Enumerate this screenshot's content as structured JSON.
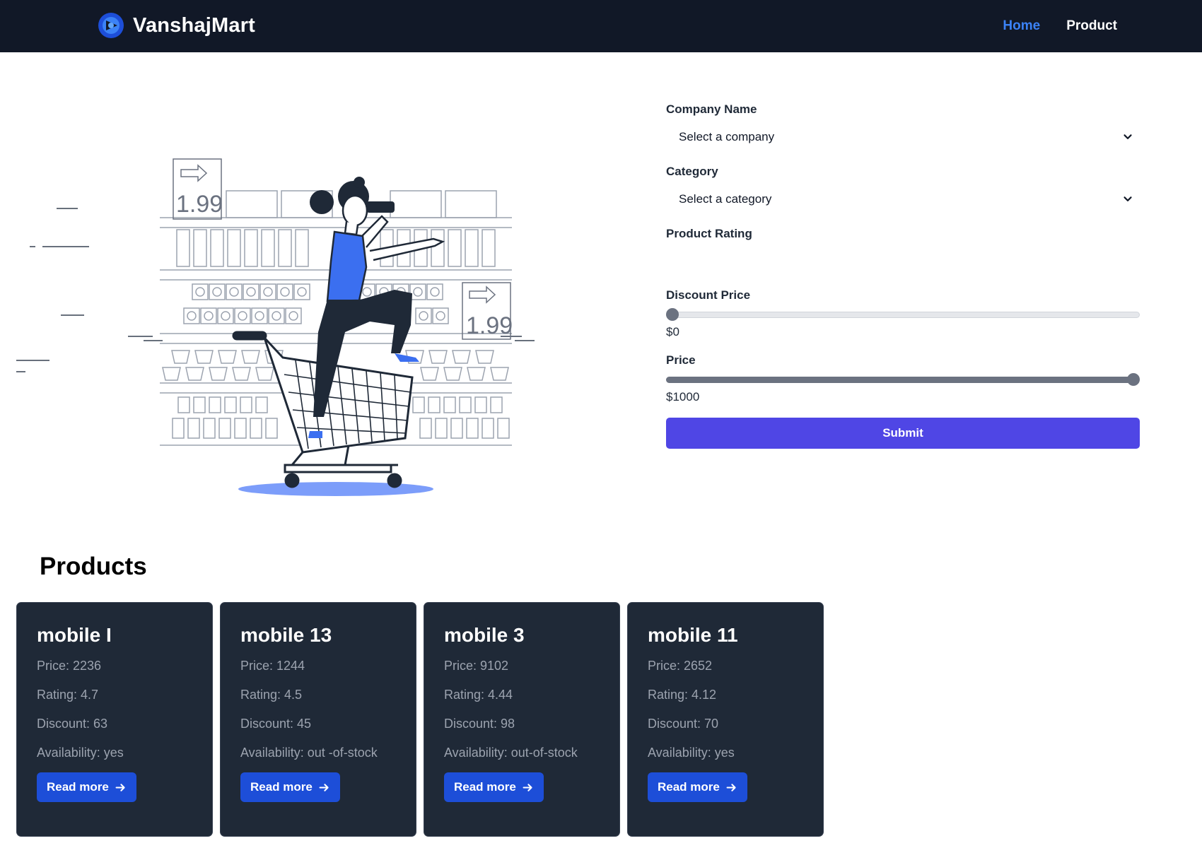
{
  "navbar": {
    "brand": "VanshajMart",
    "links": [
      {
        "label": "Home",
        "active": true
      },
      {
        "label": "Product",
        "active": false
      }
    ]
  },
  "hero": {
    "price_tag_1": "1.99",
    "price_tag_2": "1.99"
  },
  "filters": {
    "company": {
      "label": "Company Name",
      "value": "Select a company"
    },
    "category": {
      "label": "Category",
      "value": "Select a category"
    },
    "rating": {
      "label": "Product Rating"
    },
    "discount": {
      "label": "Discount Price",
      "value_text": "$0",
      "level": 0
    },
    "price": {
      "label": "Price",
      "value_text": "$1000",
      "level": 1
    },
    "submit_label": "Submit"
  },
  "products": {
    "title": "Products",
    "items": [
      {
        "name": "mobile I",
        "price": "Price: 2236",
        "rating": "Rating: 4.7",
        "discount": "Discount: 63",
        "availability": "Availability: yes",
        "button": "Read more"
      },
      {
        "name": "mobile 13",
        "price": "Price: 1244",
        "rating": "Rating: 4.5",
        "discount": "Discount: 45",
        "availability": "Availability: out -of-stock",
        "button": "Read more"
      },
      {
        "name": "mobile 3",
        "price": "Price: 9102",
        "rating": "Rating: 4.44",
        "discount": "Discount: 98",
        "availability": "Availability: out-of-stock",
        "button": "Read more"
      },
      {
        "name": "mobile 11",
        "price": "Price: 2652",
        "rating": "Rating: 4.12",
        "discount": "Discount: 70",
        "availability": "Availability: yes",
        "button": "Read more"
      }
    ]
  },
  "colors": {
    "navbar_bg": "#111827",
    "accent_blue": "#3b82f6",
    "submit_bg": "#4f46e5",
    "card_bg": "#1f2937",
    "read_more_bg": "#1d4ed8"
  }
}
